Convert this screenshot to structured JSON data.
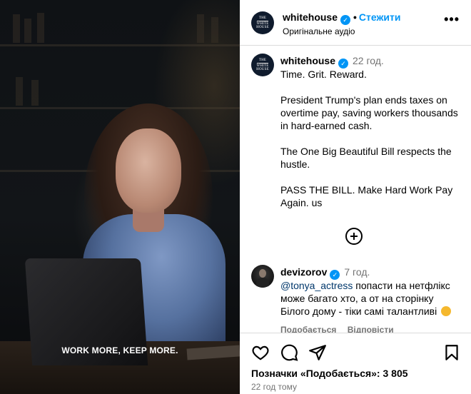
{
  "video": {
    "overlay_caption": "WORK MORE, KEEP MORE."
  },
  "header": {
    "avatar_text": [
      "THE",
      "WHITE",
      "HOUSE"
    ],
    "username": "whitehouse",
    "follow_label": "Стежити",
    "audio_label": "Оригінальне аудіо",
    "more_icon": "more-horizontal-icon"
  },
  "caption": {
    "avatar_text": [
      "THE",
      "WHITE",
      "HOUSE"
    ],
    "username": "whitehouse",
    "time": "22 год.",
    "text": "Time. Grit. Reward.\n\nPresident Trump's plan ends taxes on overtime pay, saving workers thousands in hard-earned cash.\n\nThe One Big Beautiful Bill respects the hustle.\n\nPASS THE BILL. Make Hard Work Pay Again. us",
    "load_more_icon": "plus-circle-icon"
  },
  "comment": {
    "username": "devizorov",
    "time": "7 год.",
    "mention": "@tonya_actress",
    "text": " попасти на нетфлікс може багато хто, а от на сторінку Білого дому - тіки самі талантливі",
    "emoji_icon": "clapping-hands-icon",
    "like_label": "Подобається",
    "reply_label": "Відповісти"
  },
  "actions": {
    "likes_text": "Позначки «Подобається»: 3 805",
    "posted_time": "22 год тому"
  },
  "colors": {
    "accent": "#0095f6",
    "muted": "#737373",
    "mention": "#00376b",
    "divider": "#dbdbdb"
  }
}
